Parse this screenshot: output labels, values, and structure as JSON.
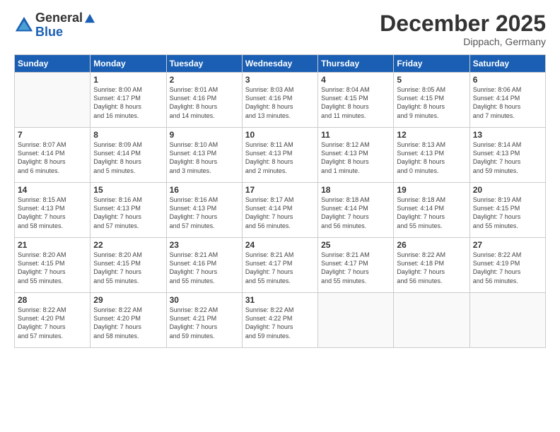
{
  "header": {
    "logo_line1": "General",
    "logo_line2": "Blue",
    "month_title": "December 2025",
    "location": "Dippach, Germany"
  },
  "days_of_week": [
    "Sunday",
    "Monday",
    "Tuesday",
    "Wednesday",
    "Thursday",
    "Friday",
    "Saturday"
  ],
  "weeks": [
    [
      {
        "day": "",
        "info": ""
      },
      {
        "day": "1",
        "info": "Sunrise: 8:00 AM\nSunset: 4:17 PM\nDaylight: 8 hours\nand 16 minutes."
      },
      {
        "day": "2",
        "info": "Sunrise: 8:01 AM\nSunset: 4:16 PM\nDaylight: 8 hours\nand 14 minutes."
      },
      {
        "day": "3",
        "info": "Sunrise: 8:03 AM\nSunset: 4:16 PM\nDaylight: 8 hours\nand 13 minutes."
      },
      {
        "day": "4",
        "info": "Sunrise: 8:04 AM\nSunset: 4:15 PM\nDaylight: 8 hours\nand 11 minutes."
      },
      {
        "day": "5",
        "info": "Sunrise: 8:05 AM\nSunset: 4:15 PM\nDaylight: 8 hours\nand 9 minutes."
      },
      {
        "day": "6",
        "info": "Sunrise: 8:06 AM\nSunset: 4:14 PM\nDaylight: 8 hours\nand 7 minutes."
      }
    ],
    [
      {
        "day": "7",
        "info": "Sunrise: 8:07 AM\nSunset: 4:14 PM\nDaylight: 8 hours\nand 6 minutes."
      },
      {
        "day": "8",
        "info": "Sunrise: 8:09 AM\nSunset: 4:14 PM\nDaylight: 8 hours\nand 5 minutes."
      },
      {
        "day": "9",
        "info": "Sunrise: 8:10 AM\nSunset: 4:13 PM\nDaylight: 8 hours\nand 3 minutes."
      },
      {
        "day": "10",
        "info": "Sunrise: 8:11 AM\nSunset: 4:13 PM\nDaylight: 8 hours\nand 2 minutes."
      },
      {
        "day": "11",
        "info": "Sunrise: 8:12 AM\nSunset: 4:13 PM\nDaylight: 8 hours\nand 1 minute."
      },
      {
        "day": "12",
        "info": "Sunrise: 8:13 AM\nSunset: 4:13 PM\nDaylight: 8 hours\nand 0 minutes."
      },
      {
        "day": "13",
        "info": "Sunrise: 8:14 AM\nSunset: 4:13 PM\nDaylight: 7 hours\nand 59 minutes."
      }
    ],
    [
      {
        "day": "14",
        "info": "Sunrise: 8:15 AM\nSunset: 4:13 PM\nDaylight: 7 hours\nand 58 minutes."
      },
      {
        "day": "15",
        "info": "Sunrise: 8:16 AM\nSunset: 4:13 PM\nDaylight: 7 hours\nand 57 minutes."
      },
      {
        "day": "16",
        "info": "Sunrise: 8:16 AM\nSunset: 4:13 PM\nDaylight: 7 hours\nand 57 minutes."
      },
      {
        "day": "17",
        "info": "Sunrise: 8:17 AM\nSunset: 4:14 PM\nDaylight: 7 hours\nand 56 minutes."
      },
      {
        "day": "18",
        "info": "Sunrise: 8:18 AM\nSunset: 4:14 PM\nDaylight: 7 hours\nand 56 minutes."
      },
      {
        "day": "19",
        "info": "Sunrise: 8:18 AM\nSunset: 4:14 PM\nDaylight: 7 hours\nand 55 minutes."
      },
      {
        "day": "20",
        "info": "Sunrise: 8:19 AM\nSunset: 4:15 PM\nDaylight: 7 hours\nand 55 minutes."
      }
    ],
    [
      {
        "day": "21",
        "info": "Sunrise: 8:20 AM\nSunset: 4:15 PM\nDaylight: 7 hours\nand 55 minutes."
      },
      {
        "day": "22",
        "info": "Sunrise: 8:20 AM\nSunset: 4:15 PM\nDaylight: 7 hours\nand 55 minutes."
      },
      {
        "day": "23",
        "info": "Sunrise: 8:21 AM\nSunset: 4:16 PM\nDaylight: 7 hours\nand 55 minutes."
      },
      {
        "day": "24",
        "info": "Sunrise: 8:21 AM\nSunset: 4:17 PM\nDaylight: 7 hours\nand 55 minutes."
      },
      {
        "day": "25",
        "info": "Sunrise: 8:21 AM\nSunset: 4:17 PM\nDaylight: 7 hours\nand 55 minutes."
      },
      {
        "day": "26",
        "info": "Sunrise: 8:22 AM\nSunset: 4:18 PM\nDaylight: 7 hours\nand 56 minutes."
      },
      {
        "day": "27",
        "info": "Sunrise: 8:22 AM\nSunset: 4:19 PM\nDaylight: 7 hours\nand 56 minutes."
      }
    ],
    [
      {
        "day": "28",
        "info": "Sunrise: 8:22 AM\nSunset: 4:20 PM\nDaylight: 7 hours\nand 57 minutes."
      },
      {
        "day": "29",
        "info": "Sunrise: 8:22 AM\nSunset: 4:20 PM\nDaylight: 7 hours\nand 58 minutes."
      },
      {
        "day": "30",
        "info": "Sunrise: 8:22 AM\nSunset: 4:21 PM\nDaylight: 7 hours\nand 59 minutes."
      },
      {
        "day": "31",
        "info": "Sunrise: 8:22 AM\nSunset: 4:22 PM\nDaylight: 7 hours\nand 59 minutes."
      },
      {
        "day": "",
        "info": ""
      },
      {
        "day": "",
        "info": ""
      },
      {
        "day": "",
        "info": ""
      }
    ]
  ]
}
